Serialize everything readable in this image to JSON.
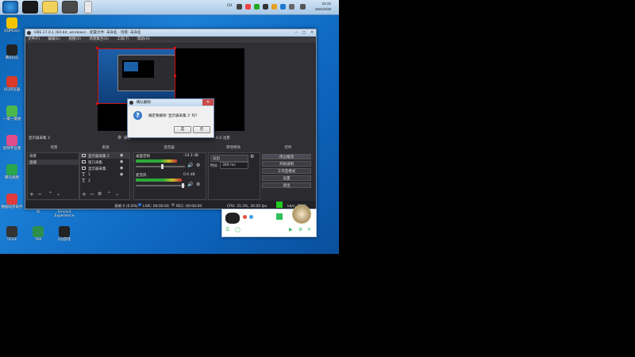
{
  "taskbar": {
    "clock_time": "22:42",
    "clock_date": "2021/6/28",
    "tray_language": "CH"
  },
  "desktop": {
    "icons": [
      {
        "label": "QQMusic"
      },
      {
        "label": "腾讯QQ"
      },
      {
        "label": "QQ浏览器"
      },
      {
        "label": "一键一键通"
      },
      {
        "label": "剪映专业版"
      },
      {
        "label": "腾讯视频"
      },
      {
        "label": "数据同步助手"
      },
      {
        "label": "W"
      },
      {
        "label": "Tencent Experience"
      },
      {
        "label": "TEVIE"
      },
      {
        "label": "TIM"
      },
      {
        "label": "QQ游戏"
      }
    ]
  },
  "obs": {
    "title": "OBS 27.0.1 (64-bit, windows) - 配置文件: 未命名 - 场景: 未命名",
    "menu": [
      "文件(F)",
      "编辑(E)",
      "视图(V)",
      "场景集合(S)",
      "工具(T)",
      "帮助(H)"
    ],
    "source_label": "显示器采集 3",
    "properties_btn": "属性",
    "filters_btn": "滤镜",
    "scene_transition": "0.4 注意",
    "scenes_header": "场景",
    "scenes": [
      "场景",
      "直播"
    ],
    "sources_header": "来源",
    "sources": [
      "显示器采集 2",
      "窗口采集",
      "显示器采集",
      "1",
      "2"
    ],
    "mixer_header": "混音器",
    "mixer": [
      {
        "name": "桌面音频",
        "db": "-14.3 dB"
      },
      {
        "name": "麦克风",
        "db": "0.0 dB"
      }
    ],
    "transitions_header": "转场特效",
    "transition_type": "淡出",
    "duration_label": "时长",
    "duration_value": "300 ms",
    "controls_header": "控件",
    "controls": [
      "停止推流",
      "开始录制",
      "工作室模式",
      "设置",
      "退出"
    ],
    "status": {
      "dropped": "丢帧 0 (0.0%)",
      "live": "LIVE: 00:00:04",
      "rec": "REC: 00:00:00",
      "cpu": "CPU: 35.3%, 30.00 fps",
      "bitrate": "kb/s: 7097"
    }
  },
  "dialog": {
    "title": "确认删除",
    "message": "确定要删除 '显示器采集 2' 吗？",
    "yes": "是",
    "no": "否"
  },
  "colors": {
    "desktop": "#1b7fd6",
    "obs_bg": "#2b2b30",
    "meter_green": "#2fa83a",
    "live_indicator": "#22cc22"
  }
}
